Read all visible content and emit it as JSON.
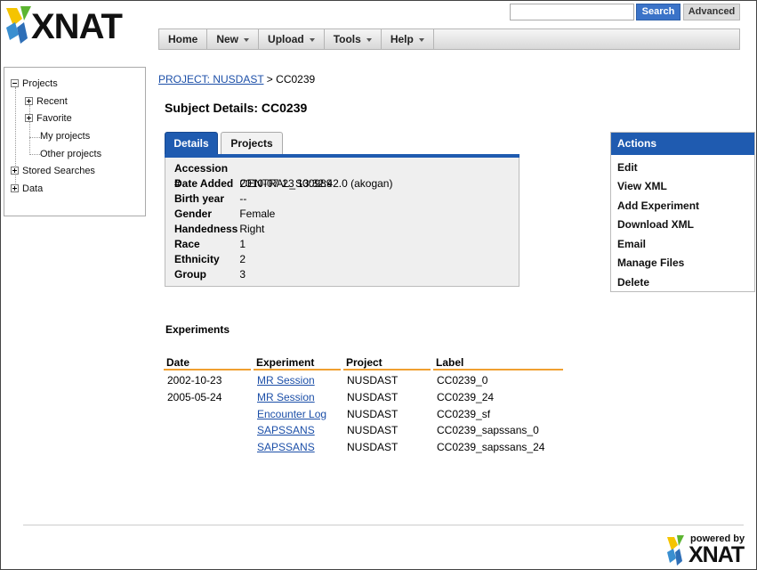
{
  "app": {
    "logo_text": "XNAT"
  },
  "search": {
    "value": "",
    "search_label": "Search",
    "advanced_label": "Advanced"
  },
  "nav": {
    "home": "Home",
    "new": "New",
    "upload": "Upload",
    "tools": "Tools",
    "help": "Help"
  },
  "tree": {
    "projects": "Projects",
    "recent": "Recent",
    "favorite": "Favorite",
    "my_projects": "My projects",
    "other_projects": "Other projects",
    "stored_searches": "Stored Searches",
    "data": "Data"
  },
  "breadcrumb": {
    "project_link": "PROJECT: NUSDAST",
    "separator": " > ",
    "current": "CC0239"
  },
  "page_title": "Subject Details: CC0239",
  "tabs": {
    "details": "Details",
    "projects": "Projects"
  },
  "details": [
    {
      "key": "Accession #",
      "value": "CENTRAL_S00989"
    },
    {
      "key": "Date Added",
      "value": "2010-07-23 13:32:42.0 (akogan)"
    },
    {
      "key": "Birth year",
      "value": "--"
    },
    {
      "key": "Gender",
      "value": "Female"
    },
    {
      "key": "Handedness",
      "value": "Right"
    },
    {
      "key": "Race",
      "value": "1"
    },
    {
      "key": "Ethnicity",
      "value": "2"
    },
    {
      "key": "Group",
      "value": "3"
    }
  ],
  "actions": {
    "title": "Actions",
    "items": [
      "Edit",
      "View XML",
      "Add Experiment",
      "Download XML",
      "Email",
      "Manage Files",
      "Delete"
    ]
  },
  "experiments": {
    "title": "Experiments",
    "columns": [
      "Date",
      "Experiment",
      "Project",
      "Label"
    ],
    "rows": [
      {
        "date": "2002-10-23",
        "experiment": "MR Session",
        "project": "NUSDAST",
        "label": "CC0239_0"
      },
      {
        "date": "2005-05-24",
        "experiment": "MR Session",
        "project": "NUSDAST",
        "label": "CC0239_24"
      },
      {
        "date": "",
        "experiment": "Encounter Log",
        "project": "NUSDAST",
        "label": "CC0239_sf"
      },
      {
        "date": "",
        "experiment": "SAPSSANS",
        "project": "NUSDAST",
        "label": "CC0239_sapssans_0"
      },
      {
        "date": "",
        "experiment": "SAPSSANS",
        "project": "NUSDAST",
        "label": "CC0239_sapssans_24"
      }
    ]
  },
  "footer": {
    "powered_by": "powered by",
    "logo_text": "XNAT"
  },
  "colors": {
    "accent_blue": "#1f5bb0",
    "header_underline": "#f0a030",
    "link": "#1c4fa8"
  }
}
